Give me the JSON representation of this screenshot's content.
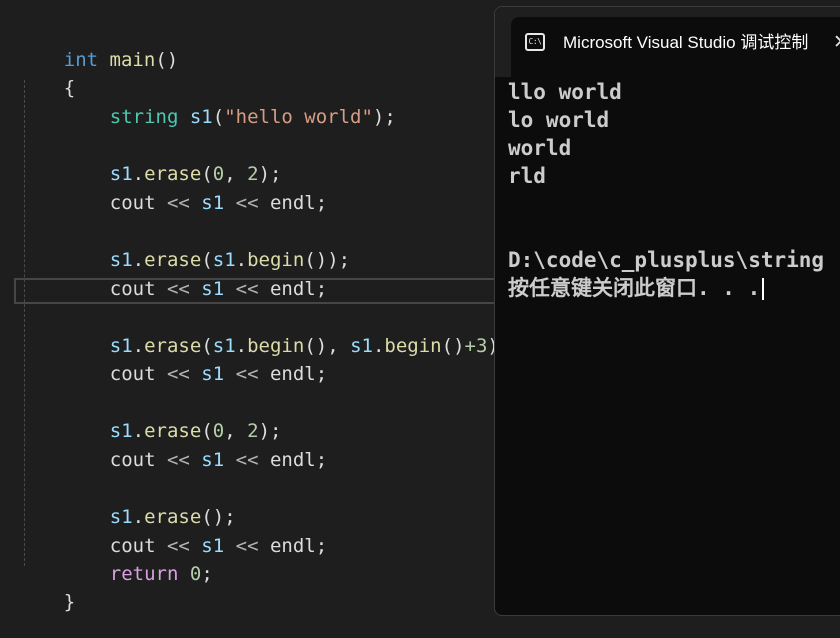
{
  "editor": {
    "lines": [
      {
        "t1": "int",
        "t2": " ",
        "t3": "main",
        "t4": "()"
      },
      {
        "t1": "{"
      },
      {
        "t1": "string",
        "t2": " ",
        "t3": "s1",
        "t4": "(",
        "t5": "\"hello world\"",
        "t6": ");"
      },
      {
        "t1": "s1",
        "t2": ".",
        "t3": "erase",
        "t4": "(",
        "t5": "0",
        "t6": ", ",
        "t7": "2",
        "t8": ");"
      },
      {
        "t1": "cout",
        "t2": " << ",
        "t3": "s1",
        "t4": " << ",
        "t5": "endl",
        "t6": ";"
      },
      {
        "t1": "s1",
        "t2": ".",
        "t3": "erase",
        "t4": "(",
        "t5": "s1",
        "t6": ".",
        "t7": "begin",
        "t8": "());"
      },
      {
        "t1": "cout",
        "t2": " << ",
        "t3": "s1",
        "t4": " << ",
        "t5": "endl",
        "t6": ";"
      },
      {
        "t1": "s1",
        "t2": ".",
        "t3": "erase",
        "t4": "(",
        "t5": "s1",
        "t6": ".",
        "t7": "begin",
        "t8": "(), ",
        "t9": "s1",
        "t10": ".",
        "t11": "begin",
        "t12": "()",
        "t13": "+3",
        "t14": ");"
      },
      {
        "t1": "cout",
        "t2": " << ",
        "t3": "s1",
        "t4": " << ",
        "t5": "endl",
        "t6": ";"
      },
      {
        "t1": "s1",
        "t2": ".",
        "t3": "erase",
        "t4": "(",
        "t5": "0",
        "t6": ", ",
        "t7": "2",
        "t8": ");"
      },
      {
        "t1": "cout",
        "t2": " << ",
        "t3": "s1",
        "t4": " << ",
        "t5": "endl",
        "t6": ";"
      },
      {
        "t1": "s1",
        "t2": ".",
        "t3": "erase",
        "t4": "();"
      },
      {
        "t1": "cout",
        "t2": " << ",
        "t3": "s1",
        "t4": " << ",
        "t5": "endl",
        "t6": ";"
      },
      {
        "t1": "return",
        "t2": " ",
        "t3": "0",
        "t4": ";"
      },
      {
        "t1": "}"
      }
    ]
  },
  "console": {
    "tab_icon_label": "C:\\",
    "title": "Microsoft Visual Studio 调试控制台",
    "close_glyph": "✕",
    "lines": [
      "llo world",
      "lo world",
      "world",
      "rld",
      "D:\\code\\c_plusplus\\string",
      "按任意键关闭此窗口. . ."
    ]
  },
  "colors": {
    "editor_background": "#1e1e1e",
    "keyword": "#569cd6",
    "control_keyword": "#d8a0df",
    "type": "#4ec9b0",
    "variable": "#9cdcfe",
    "function": "#dcdcaa",
    "string": "#d69d85",
    "number": "#b5cea8",
    "console_background": "#0c0c0c"
  }
}
